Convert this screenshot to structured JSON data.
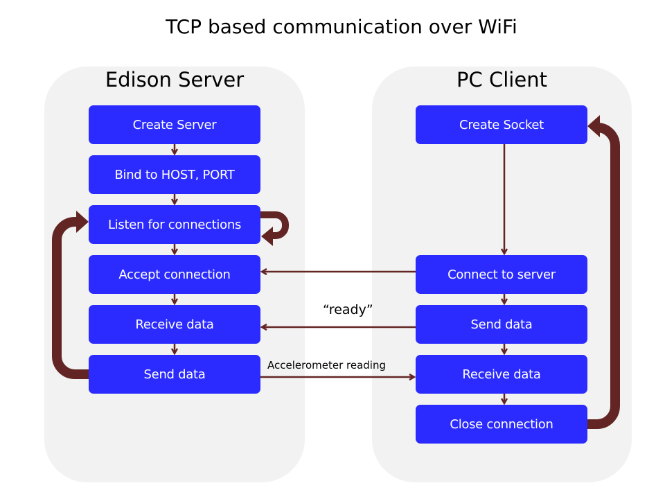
{
  "title": "TCP based communication over WiFi",
  "colors": {
    "panel": "#f2f2f2",
    "step": "#2b2bff",
    "step_text": "#ffffff",
    "arrow": "#632523"
  },
  "server": {
    "title": "Edison Server",
    "steps": [
      "Create Server",
      "Bind to HOST, PORT",
      "Listen for connections",
      "Accept connection",
      "Receive data",
      "Send data"
    ]
  },
  "client": {
    "title": "PC Client",
    "steps": [
      "Create Socket",
      "Connect to server",
      "Send data",
      "Receive data",
      "Close connection"
    ]
  },
  "messages": {
    "connect": "",
    "ready": "“ready”",
    "accelerometer": "Accelerometer reading"
  },
  "flows": [
    {
      "from": "client.Connect to server",
      "to": "server.Accept connection",
      "label": ""
    },
    {
      "from": "client.Send data",
      "to": "server.Receive data",
      "label": "“ready”"
    },
    {
      "from": "server.Send data",
      "to": "client.Receive data",
      "label": "Accelerometer reading"
    },
    {
      "from": "server.Listen for connections",
      "to": "server.Listen for connections",
      "label": "",
      "kind": "self-loop"
    },
    {
      "from": "server.Send data",
      "to": "server.Listen for connections",
      "label": "",
      "kind": "loop-back"
    },
    {
      "from": "client.Close connection",
      "to": "client.Create Socket",
      "label": "",
      "kind": "loop-back"
    }
  ]
}
